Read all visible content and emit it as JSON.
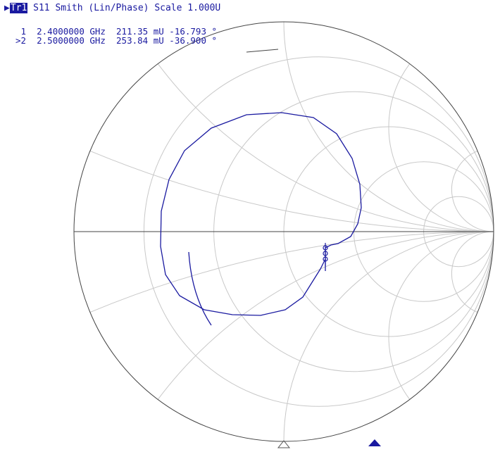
{
  "trace": {
    "id": "Tr1",
    "title": "S11 Smith (Lin/Phase) Scale 1.000U",
    "color": "#1a1aa0"
  },
  "markers": [
    {
      "label": " 1",
      "freq": "2.4000000 GHz",
      "mag": "211.35 mU",
      "phase": "-16.793 °"
    },
    {
      "label": ">2",
      "freq": "2.5000000 GHz",
      "mag": "253.84 mU",
      "phase": "-36.900 °"
    }
  ]
}
